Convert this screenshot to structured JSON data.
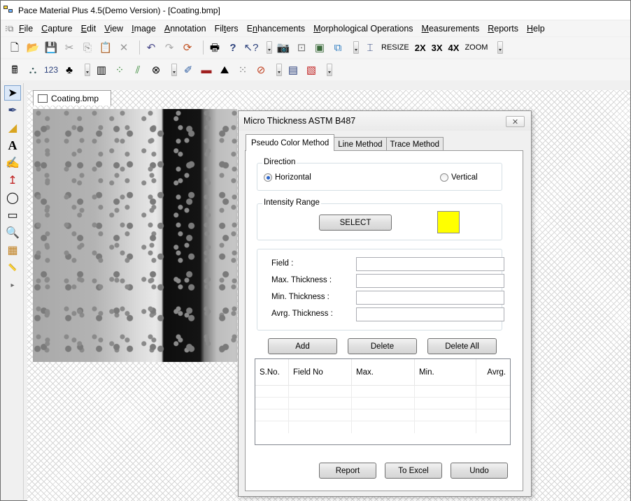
{
  "window": {
    "title": "Pace Material Plus 4.5(Demo Version) - [Coating.bmp]"
  },
  "menu": [
    "File",
    "Capture",
    "Edit",
    "View",
    "Image",
    "Annotation",
    "Filters",
    "Enhancements",
    "Morphological Operations",
    "Measurements",
    "Reports",
    "Help"
  ],
  "menu_underline": [
    "F",
    "C",
    "E",
    "V",
    "I",
    "A",
    "t",
    "n",
    "M",
    "M",
    "R",
    "H"
  ],
  "toolbar": {
    "resize_label": "RESIZE",
    "zoom2_label": "2X",
    "zoom3_label": "3X",
    "zoom4_label": "4X",
    "zoom_label": "ZOOM",
    "count_label": "123"
  },
  "left_tools": [
    "pointer-tool",
    "pen-tool",
    "eraser-tool",
    "text-tool",
    "brush-tool",
    "vertical-measure-tool",
    "ellipse-tool",
    "rectangle-tool",
    "zoom-tool",
    "palette-tool",
    "ruler-tool",
    "collapse-tool"
  ],
  "document": {
    "tab_label": "Coating.bmp"
  },
  "dialog": {
    "title": "Micro Thickness ASTM B487",
    "close_label": "✕",
    "tabs": [
      "Pseudo Color Method",
      "Line Method",
      "Trace Method"
    ],
    "direction": {
      "label": "Direction",
      "horizontal": "Horizontal",
      "vertical": "Vertical",
      "selected": "Horizontal"
    },
    "intensity": {
      "label": "Intensity Range",
      "select_button": "SELECT",
      "swatch_color": "#ffff00"
    },
    "fields": {
      "field_label": "Field :",
      "max_label": "Max. Thickness :",
      "min_label": "Min. Thickness :",
      "avg_label": "Avrg. Thickness :",
      "field_value": "",
      "max_value": "",
      "min_value": "",
      "avg_value": ""
    },
    "actions": {
      "add": "Add",
      "delete": "Delete",
      "delete_all": "Delete All"
    },
    "table": {
      "columns": [
        "S.No.",
        "Field No",
        "Max.",
        "Min.",
        "Avrg."
      ],
      "rows": []
    },
    "bottom": {
      "report": "Report",
      "to_excel": "To Excel",
      "undo": "Undo"
    }
  }
}
